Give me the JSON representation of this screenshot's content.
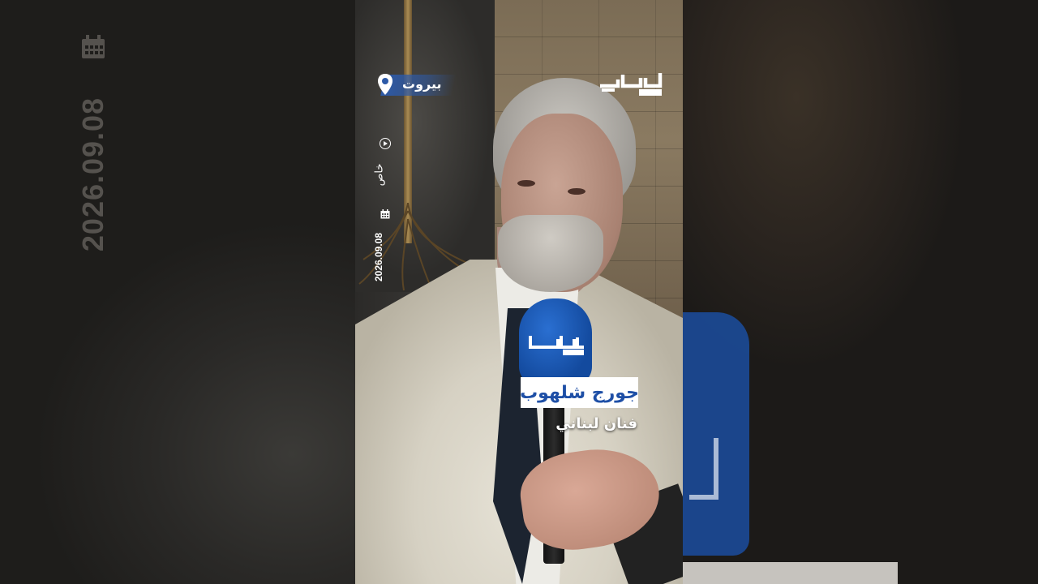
{
  "video": {
    "location": "بيروت",
    "tag": "خاص",
    "date": "2026.09.08",
    "speaker_name": "جورج شلهوب",
    "speaker_title": "فنان لبناني"
  },
  "brand": {
    "logo_icon": "jusoor-news-logo",
    "primary_color": "#1e4fa6",
    "mic_color": "#1b4ea0"
  },
  "background": {
    "blurred_date": "2026.09.08"
  }
}
